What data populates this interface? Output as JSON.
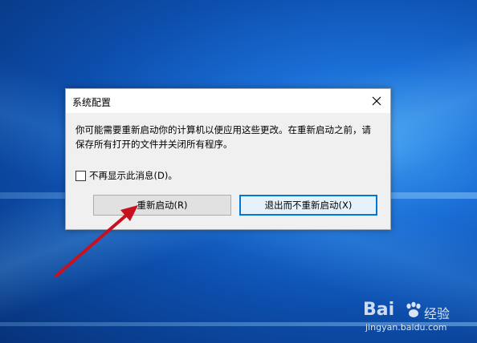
{
  "dialog": {
    "title": "系统配置",
    "message_line1": "你可能需要重新启动你的计算机以便应用这些更改。在重新启动之前，请",
    "message_line2": "保存所有打开的文件并关闭所有程序。",
    "checkbox_label": "不再显示此消息(D)。",
    "checkbox_checked": false,
    "restart_button": "重新启动(R)",
    "exit_button": "退出而不重新启动(X)"
  },
  "watermark": {
    "brand": "Bai",
    "label": "经验",
    "url": "jingyan.baidu.com"
  },
  "colors": {
    "accent": "#0078d7",
    "arrow": "#c8101e"
  },
  "icons": {
    "close": "close-icon",
    "paw": "paw-icon",
    "arrow": "arrow-annotation"
  }
}
